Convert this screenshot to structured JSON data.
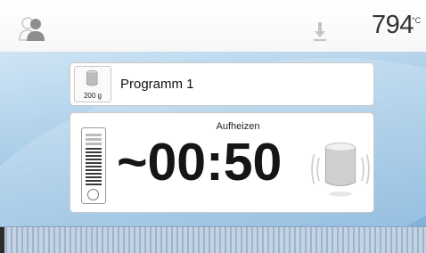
{
  "header": {
    "user_icon": "user-icon",
    "download_icon": "download-icon",
    "temperature": "794",
    "temperature_unit": "°C"
  },
  "program": {
    "icon": "crucible-icon",
    "weight": "200 g",
    "name": "Programm 1"
  },
  "status": {
    "title": "Aufheizen",
    "time": "~00:50",
    "gauge_icon": "heating-gauge-icon",
    "muffle_icon": "muffle-icon"
  },
  "progress": {
    "fraction": 0.01
  },
  "colors": {
    "background_blue": "#a9cde8",
    "accent_dark": "#151515"
  }
}
